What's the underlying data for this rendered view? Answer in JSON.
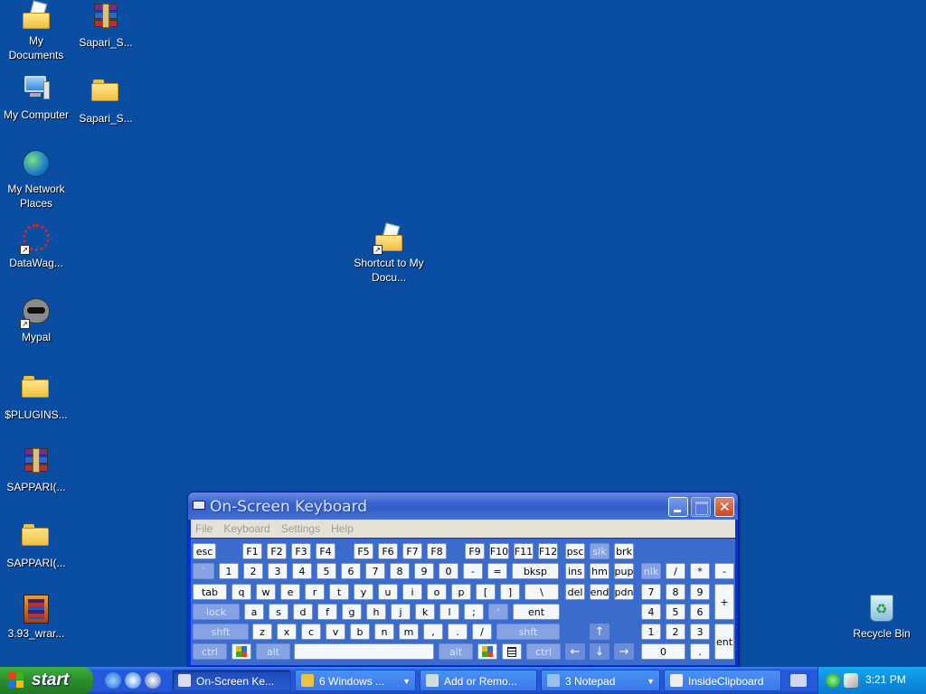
{
  "desktop_icons": [
    {
      "label": "My Documents",
      "icon": "my-documents-icon"
    },
    {
      "label": "Sapari_S...",
      "icon": "winrar-archive-icon"
    },
    {
      "label": "My Computer",
      "icon": "my-computer-icon"
    },
    {
      "label": "Sapari_S...",
      "icon": "folder-icon"
    },
    {
      "label": "My Network Places",
      "icon": "network-places-icon"
    },
    {
      "label": "DataWag...",
      "icon": "datawag-shortcut-icon"
    },
    {
      "label": "Shortcut to My Docu...",
      "icon": "my-documents-shortcut-icon"
    },
    {
      "label": "Mypal",
      "icon": "mypal-shortcut-icon"
    },
    {
      "label": "$PLUGINS...",
      "icon": "folder-icon"
    },
    {
      "label": "SAPPARI(...",
      "icon": "winrar-archive-icon"
    },
    {
      "label": "SAPPARI(...",
      "icon": "folder-icon"
    },
    {
      "label": "3.93_wrar...",
      "icon": "winrar-installer-icon"
    },
    {
      "label": "Recycle Bin",
      "icon": "recycle-bin-icon"
    }
  ],
  "osk": {
    "title": "On-Screen Keyboard",
    "menu": [
      "File",
      "Keyboard",
      "Settings",
      "Help"
    ],
    "rows": {
      "fn": [
        "esc",
        "F1",
        "F2",
        "F3",
        "F4",
        "F5",
        "F6",
        "F7",
        "F8",
        "F9",
        "F10",
        "F11",
        "F12",
        "psc",
        "slk",
        "brk"
      ],
      "num": [
        "`",
        "1",
        "2",
        "3",
        "4",
        "5",
        "6",
        "7",
        "8",
        "9",
        "0",
        "-",
        "=",
        "bksp",
        "ins",
        "hm",
        "pup",
        "nlk",
        "/",
        "*",
        "-"
      ],
      "tab": [
        "tab",
        "q",
        "w",
        "e",
        "r",
        "t",
        "y",
        "u",
        "i",
        "o",
        "p",
        "[",
        "]",
        "\\",
        "del",
        "end",
        "pdn",
        "7",
        "8",
        "9",
        "+"
      ],
      "caps": [
        "lock",
        "a",
        "s",
        "d",
        "f",
        "g",
        "h",
        "j",
        "k",
        "l",
        ";",
        "'",
        "ent",
        "4",
        "5",
        "6"
      ],
      "shift": [
        "shft",
        "z",
        "x",
        "c",
        "v",
        "b",
        "n",
        "m",
        ",",
        ".",
        "/",
        "shft",
        "1",
        "2",
        "3",
        "ent"
      ],
      "bottom": [
        "ctrl",
        "alt",
        "alt",
        "ctrl",
        "0",
        "."
      ]
    }
  },
  "taskbar": {
    "start_label": "start",
    "buttons": [
      {
        "label": "On-Screen Ke...",
        "active": true
      },
      {
        "label": "6 Windows ...",
        "dropdown": true
      },
      {
        "label": "Add or Remo..."
      },
      {
        "label": "3 Notepad",
        "dropdown": true
      },
      {
        "label": "InsideClipboard"
      }
    ],
    "clock": "3:21 PM"
  },
  "colors": {
    "desktop": "#0a4ea4",
    "taskbar": "#2458d8",
    "start": "#2c8c2c",
    "tray": "#0c8ee0",
    "osk_keys": "#3d6dce"
  }
}
